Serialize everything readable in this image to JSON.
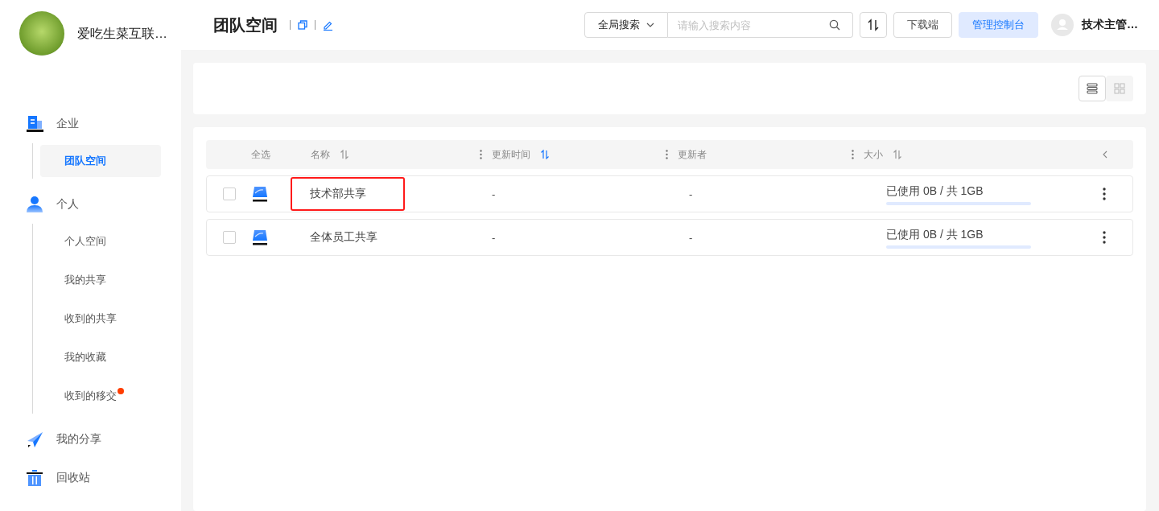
{
  "sidebar": {
    "org_name": "爱吃生菜互联…",
    "nav": [
      {
        "label": "企业",
        "children": [
          {
            "label": "团队空间",
            "selected": true,
            "dot": false
          }
        ]
      },
      {
        "label": "个人",
        "children": [
          {
            "label": "个人空间",
            "selected": false,
            "dot": false
          },
          {
            "label": "我的共享",
            "selected": false,
            "dot": false
          },
          {
            "label": "收到的共享",
            "selected": false,
            "dot": false
          },
          {
            "label": "我的收藏",
            "selected": false,
            "dot": false
          },
          {
            "label": "收到的移交",
            "selected": false,
            "dot": true
          }
        ]
      },
      {
        "label": "我的分享"
      },
      {
        "label": "回收站"
      }
    ]
  },
  "header": {
    "title": "团队空间",
    "search_scope": "全局搜索",
    "search": {
      "placeholder": "请输入搜索内容"
    },
    "download_button": "下载端",
    "admin_button": "管理控制台",
    "user_name": "技术主管…"
  },
  "view_toggle": [
    {
      "kind": "list",
      "selected": true
    },
    {
      "kind": "grid",
      "selected": false
    }
  ],
  "table": {
    "select_all": "全选",
    "columns": [
      {
        "label": "名称",
        "sorted": false
      },
      {
        "label": "更新时间",
        "sorted": true
      },
      {
        "label": "更新者"
      },
      {
        "label": "大小",
        "sorted": false
      }
    ],
    "rows": [
      {
        "checked": false,
        "name": "技术部共享",
        "updated": "-",
        "updater": "-",
        "size": "已使用 0B / 共 1GB",
        "level": 0,
        "highlighted": true
      },
      {
        "checked": false,
        "name": "全体员工共享",
        "updated": "-",
        "updater": "-",
        "size": "已使用 0B / 共 1GB",
        "level": 0,
        "highlighted": false
      }
    ]
  }
}
